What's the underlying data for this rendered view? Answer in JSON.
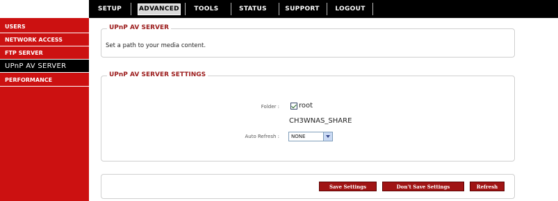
{
  "nav": {
    "tabs": [
      {
        "label": "SETUP"
      },
      {
        "label": "ADVANCED"
      },
      {
        "label": "TOOLS"
      },
      {
        "label": "STATUS"
      },
      {
        "label": "SUPPORT"
      },
      {
        "label": "LOGOUT"
      }
    ],
    "active_tab": "ADVANCED"
  },
  "sidebar": {
    "items": [
      {
        "label": "USERS"
      },
      {
        "label": "NETWORK ACCESS"
      },
      {
        "label": "FTP SERVER"
      },
      {
        "label": "UPnP AV SERVER"
      },
      {
        "label": "PERFORMANCE"
      }
    ],
    "active_item": "UPnP AV SERVER"
  },
  "server_section": {
    "title": "UPnP AV SERVER",
    "description": "Set a path to your media content."
  },
  "settings_section": {
    "title": "UPnP AV SERVER SETTINGS",
    "folder_label": "Folder :",
    "folder_checkbox_label": "root",
    "folder_checked": true,
    "share_name": "CH3WNAS_SHARE",
    "auto_refresh_label": "Auto Refresh :",
    "auto_refresh_value": "NONE"
  },
  "actions": {
    "save_label": "Save Settings",
    "dont_save_label": "Don't Save Settings",
    "refresh_label": "Refresh"
  },
  "colors": {
    "sidebar_bg": "#cc1111",
    "nav_bg": "#000000",
    "accent_title": "#9b1b1b",
    "button_bg": "#a01414"
  }
}
